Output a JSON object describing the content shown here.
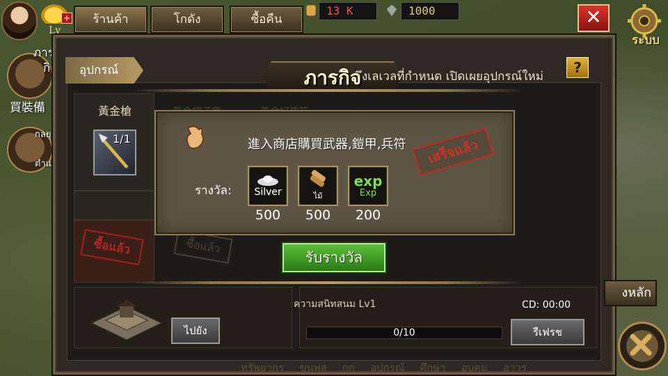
{
  "topbar": {
    "level_label": "Lv",
    "tabs": [
      "ร้านค้า",
      "โกดัง",
      "ซื้อคืน"
    ],
    "resources": {
      "red_value": "13 K",
      "gold_value": "1000"
    },
    "system_label": "ระบบ"
  },
  "side": {
    "items": [
      "ภาร",
      "กิ",
      "買裝備",
      "กลยุ",
      "ตำแห"
    ]
  },
  "panel": {
    "tab_label": "อุปกรณ์",
    "title": "ภารกิจ",
    "hint": "ึงเลเวลที่กำหนด เปิดเผยอุปกรณ์ใหม่",
    "help_label": "?",
    "item": {
      "name": "黃金槍",
      "count": "1/1"
    },
    "sold_stamp": "ซื้อแล้ว",
    "ghost_labels": [
      "黃金鎧子甲",
      "黃金好盾符"
    ],
    "mission": {
      "description": "進入商店購買武器,鎧甲,兵符",
      "done_stamp": "เสร็จแล้ว",
      "reward_label": "รางวัล:",
      "rewards": [
        {
          "icon": "silver-ingot-icon",
          "label": "Silver",
          "value": "500"
        },
        {
          "icon": "wood-log-icon",
          "label": "ไม้",
          "value": "500"
        },
        {
          "icon": "exp-icon",
          "label": "exp",
          "sublabel": "Exp",
          "value": "200"
        }
      ]
    },
    "claim_button": "รับรางวัล",
    "bottom": {
      "goto_button": "ไปยัง",
      "friend_label": "ความสนิทสนม Lv1",
      "cd_label": "CD:  00:00",
      "progress_text": "0/10",
      "progress_fraction": 0,
      "refresh_button": "รีเฟรช"
    },
    "footer_tabs": [
      "ทรัพยากร",
      "ขุนพล",
      "กก",
      "อุปกรณ์",
      "ศึกษา",
      "อบคม",
      "อาวร"
    ]
  },
  "right": {
    "main_button": "งหลัก"
  },
  "colors": {
    "claim_green": "#3f9a24",
    "close_red": "#c02820",
    "accent_gold": "#b89a66"
  }
}
